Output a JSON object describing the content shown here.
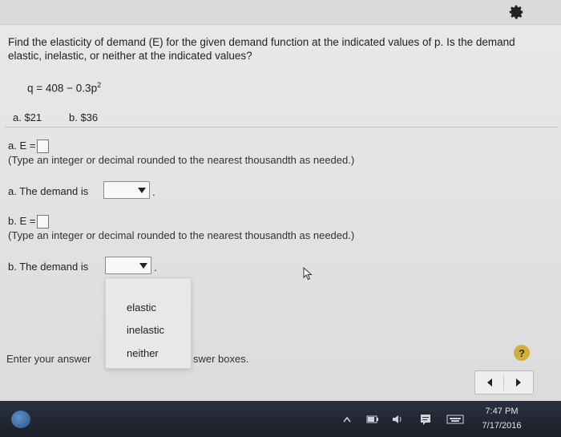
{
  "question": {
    "text": "Find the elasticity of demand (E) for the given demand function at the indicated values of p. Is the demand elastic, inelastic, or neither at the indicated values?",
    "formula_main": "q = 408 − 0.3p",
    "formula_exp": "2",
    "option_a": "a. $21",
    "option_b": "b. $36"
  },
  "part_a": {
    "e_label": "a. E =",
    "hint": "(Type an integer or decimal rounded to the nearest thousandth as needed.)",
    "demand_label": "a. The demand is"
  },
  "part_b": {
    "e_label": "b. E =",
    "hint": "(Type an integer or decimal rounded to the nearest thousandth as needed.)",
    "demand_label": "b. The demand is"
  },
  "dropdown": {
    "options": [
      "elastic",
      "inelastic",
      "neither"
    ]
  },
  "footer": {
    "text_left": "Enter your answer",
    "text_right": "swer boxes.",
    "help": "?"
  },
  "taskbar": {
    "time": "7:47 PM",
    "date": "7/17/2016"
  },
  "icons": {
    "settings": "gear-icon",
    "help": "question-icon",
    "prev": "chevron-left-icon",
    "next": "chevron-right-icon"
  }
}
